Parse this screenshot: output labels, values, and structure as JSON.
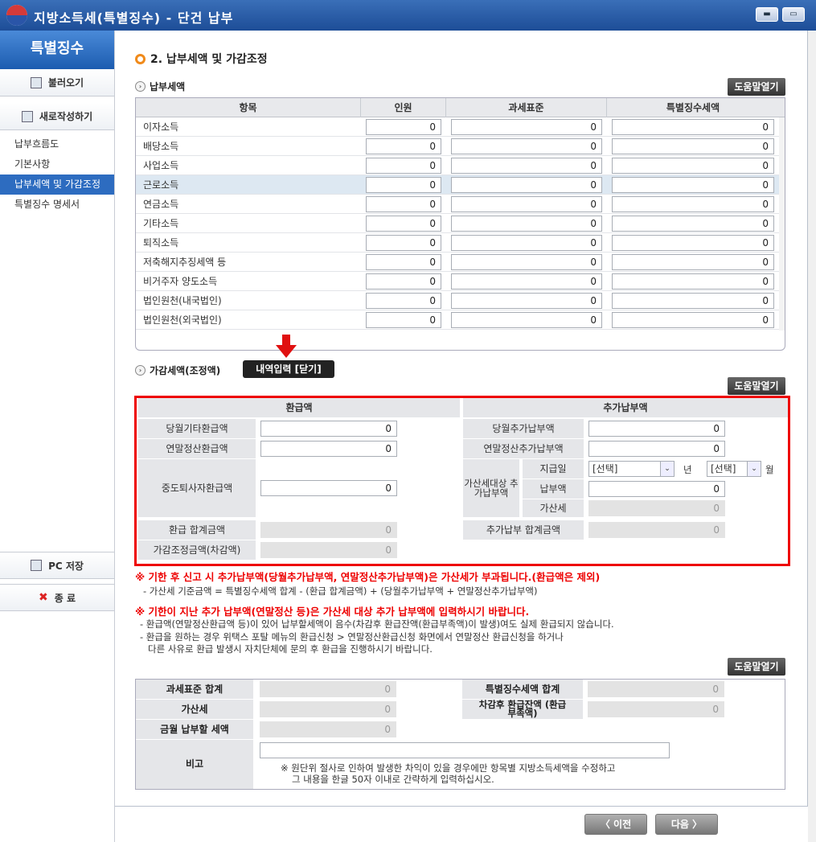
{
  "window": {
    "title": "지방소득세(특별징수) - 단건 납부",
    "min": "▬",
    "max": "▭"
  },
  "sidebar": {
    "header": "특별징수",
    "load_btn": "불러오기",
    "new_btn": "새로작성하기",
    "items": [
      "납부흐름도",
      "기본사항",
      "납부세액 및 가감조정",
      "특별징수 명세서"
    ],
    "pc_save": "PC 저장",
    "exit": "종 료"
  },
  "section_title": "2. 납부세액 및 가감조정",
  "payment": {
    "title": "납부세액",
    "help": "도움말열기",
    "headers": [
      "항목",
      "인원",
      "과세표준",
      "특별징수세액"
    ],
    "rows": [
      {
        "label": "이자소득",
        "v": [
          "0",
          "0",
          "0"
        ]
      },
      {
        "label": "배당소득",
        "v": [
          "0",
          "0",
          "0"
        ]
      },
      {
        "label": "사업소득",
        "v": [
          "0",
          "0",
          "0"
        ]
      },
      {
        "label": "근로소득",
        "v": [
          "0",
          "0",
          "0"
        ]
      },
      {
        "label": "연금소득",
        "v": [
          "0",
          "0",
          "0"
        ]
      },
      {
        "label": "기타소득",
        "v": [
          "0",
          "0",
          "0"
        ]
      },
      {
        "label": "퇴직소득",
        "v": [
          "0",
          "0",
          "0"
        ]
      },
      {
        "label": "저축해지추징세액 등",
        "v": [
          "0",
          "0",
          "0"
        ]
      },
      {
        "label": "비거주자 양도소득",
        "v": [
          "0",
          "0",
          "0"
        ]
      },
      {
        "label": "법인원천(내국법인)",
        "v": [
          "0",
          "0",
          "0"
        ]
      },
      {
        "label": "법인원천(외국법인)",
        "v": [
          "0",
          "0",
          "0"
        ]
      }
    ]
  },
  "adjust": {
    "title": "가감세액(조정액)",
    "toggle": "내역입력 [닫기]",
    "help": "도움말열기",
    "refund_head": "환급액",
    "extra_head": "추가납부액",
    "refund1": "당월기타환급액",
    "refund1_v": "0",
    "refund2": "연말정산환급액",
    "refund2_v": "0",
    "refund3": "중도퇴사자환급액",
    "refund3_v": "0",
    "refund_total": "환급 합계금액",
    "refund_total_v": "0",
    "adj_amount": "가감조정금액(차감액)",
    "adj_amount_v": "0",
    "extra1": "당월추가납부액",
    "extra1_v": "0",
    "extra2": "연말정산추가납부액",
    "extra2_v": "0",
    "penalty_group": "가산세대상 추가납부액",
    "pay_date": "지급일",
    "year_sel": "[선택]",
    "year_unit": "년",
    "month_sel": "[선택]",
    "month_unit": "월",
    "pay_amt": "납부액",
    "pay_amt_v": "0",
    "penalty": "가산세",
    "penalty_v": "0",
    "extra_total": "추가납부 합계금액",
    "extra_total_v": "0"
  },
  "notes": {
    "w1": "※ 기한 후 신고 시 추가납부액(당월추가납부액, 연말정산추가납부액)은 가산세가 부과됩니다.(환급액은 제외)",
    "n1": "- 가산세 기준금액 = 특별징수세액 합계 - (환급 합계금액) + (당월추가납부액 + 연말정산추가납부액)",
    "w2": "※ 기한이 지난 추가 납부액(연말정산 등)은 가산세 대상 추가 납부액에 입력하시기 바랍니다.",
    "n2": "- 환급액(연말정산환급액 등)이 있어 납부할세액이 음수(차감후 환급잔액(환급부족액)이 발생)여도 실제 환급되지 않습니다.",
    "n3": "- 환급을 원하는 경우 위택스 포탈 메뉴의 환급신청 > 연말정산환급신청 화면에서 연말정산 환급신청을 하거나",
    "n4": "다른 사유로 환급 발생시 자치단체에 문의 후 환급을 진행하시기 바랍니다."
  },
  "summary": {
    "help": "도움말열기",
    "tax_base_total": "과세표준 합계",
    "tax_base_total_v": "0",
    "wh_total": "특별징수세액 합계",
    "wh_total_v": "0",
    "penalty": "가산세",
    "penalty_v": "0",
    "after_refund": "차감후 환급잔액 (환급부족액)",
    "after_refund_v": "0",
    "month_pay": "금월 납부할 세액",
    "month_pay_v": "0",
    "remark": "비고",
    "remark_note1": "※ 원단위 절사로 인하여 발생한 차익이 있을 경우에만 항목별 지방소득세액을 수정하고",
    "remark_note2": "그 내용을 한글 50자 이내로 간략하게 입력하십시오."
  },
  "nav": {
    "prev": "〈 이전",
    "next": "다음 〉"
  }
}
